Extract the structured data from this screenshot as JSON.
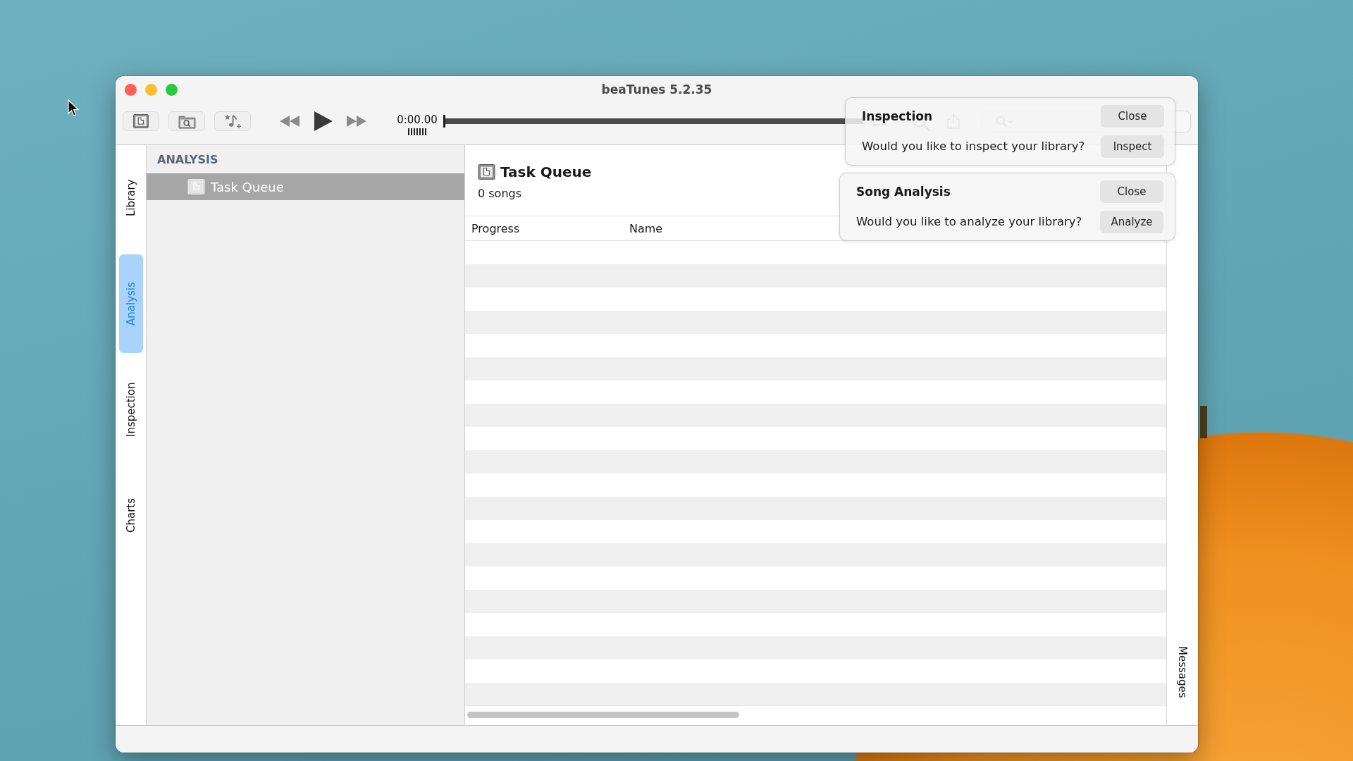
{
  "window": {
    "title": "beaTunes 5.2.35"
  },
  "player": {
    "time": "0:00.00",
    "level": 0
  },
  "side_tabs": [
    {
      "label": "Library",
      "selected": false
    },
    {
      "label": "Analysis",
      "selected": true
    },
    {
      "label": "Inspection",
      "selected": false
    },
    {
      "label": "Charts",
      "selected": false
    }
  ],
  "sidebar": {
    "section": "ANALYSIS",
    "items": [
      {
        "label": "Task Queue",
        "selected": true
      }
    ]
  },
  "content": {
    "title": "Task Queue",
    "subtitle": "0 songs"
  },
  "table": {
    "columns": [
      "Progress",
      "Name"
    ]
  },
  "right_tabs": [
    {
      "label": "Messages",
      "selected": false
    }
  ],
  "notifications": [
    {
      "title": "Inspection",
      "message": "Would you like to inspect your library?",
      "buttons": [
        "Close",
        "Inspect"
      ]
    },
    {
      "title": "Song Analysis",
      "message": "Would you like to analyze your library?",
      "buttons": [
        "Close",
        "Analyze"
      ]
    }
  ]
}
